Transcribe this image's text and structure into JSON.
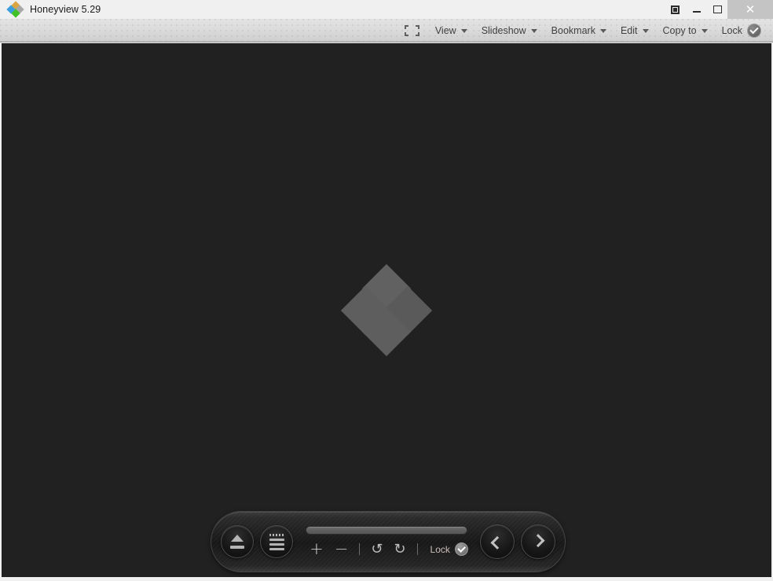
{
  "window": {
    "title": "Honeyview 5.29",
    "logo_icon": "honeyview-diamond-logo",
    "controls": {
      "expand_label": "⬛",
      "expand_icon": "expand-window-icon",
      "minimize_icon": "minimize-icon",
      "maximize_icon": "maximize-icon",
      "close_label": "✕",
      "close_icon": "close-icon"
    },
    "colors": {
      "titlebar_bg": "#f0f0f0",
      "menubar_bg": "#dcdcdc",
      "canvas_bg": "#212121",
      "close_hover_bg": "#c4c4c4",
      "toolbar_bg": "#1c1c1c"
    }
  },
  "menubar": {
    "fit_icon": "fit-to-window-icon",
    "items": [
      {
        "label": "View",
        "icon": "chevron-down-icon"
      },
      {
        "label": "Slideshow",
        "icon": "chevron-down-icon"
      },
      {
        "label": "Bookmark",
        "icon": "chevron-down-icon"
      },
      {
        "label": "Edit",
        "icon": "chevron-down-icon"
      },
      {
        "label": "Copy to",
        "icon": "chevron-down-icon"
      }
    ],
    "lock": {
      "label": "Lock",
      "icon": "check-circle-icon",
      "state": "on"
    }
  },
  "canvas": {
    "watermark_icon": "honeyview-watermark-logo",
    "image_loaded": false
  },
  "toolbar": {
    "eject": {
      "label": "Eject",
      "icon": "eject-icon"
    },
    "menu": {
      "label": "Menu",
      "icon": "hamburger-menu-icon"
    },
    "progress": {
      "value": 100,
      "label": ""
    },
    "controls": [
      {
        "name": "zoom-in",
        "label": "+",
        "icon": "plus-icon"
      },
      {
        "name": "zoom-out",
        "label": "−",
        "icon": "minus-icon"
      },
      {
        "name": "separator-1",
        "label": "",
        "icon": "divider"
      },
      {
        "name": "rotate-left",
        "label": "↺",
        "icon": "undo-icon"
      },
      {
        "name": "rotate-right",
        "label": "↻",
        "icon": "redo-icon"
      },
      {
        "name": "separator-2",
        "label": "",
        "icon": "divider"
      }
    ],
    "lock": {
      "label": "Lock",
      "icon": "check-circle-icon",
      "state": "on"
    },
    "prev": {
      "label": "Previous",
      "icon": "chevron-left-icon"
    },
    "next": {
      "label": "Next",
      "icon": "chevron-right-icon"
    }
  }
}
